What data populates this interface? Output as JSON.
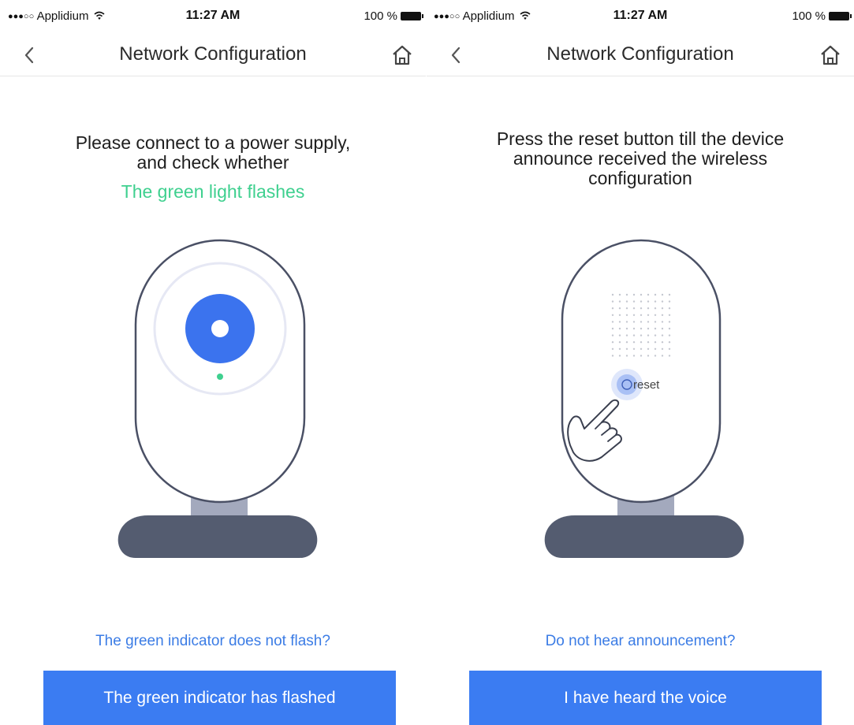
{
  "status_bar": {
    "signal": "●●●○○",
    "carrier": "Applidium",
    "time": "11:27 AM",
    "battery": "100 %"
  },
  "screens": [
    {
      "nav_title": "Network Configuration",
      "instruction_line1": "Please connect to a power supply,",
      "instruction_line2": "and check whether",
      "highlight": "The green light flashes",
      "link": "The green indicator does not flash?",
      "button": "The green indicator has flashed"
    },
    {
      "nav_title": "Network Configuration",
      "instruction_line1": "Press the reset button till the device",
      "instruction_line2": "announce received the wireless",
      "instruction_line3": "configuration",
      "reset_label": "reset",
      "link": "Do not hear announcement?",
      "button": "I have heard the voice"
    }
  ],
  "colors": {
    "accent": "#3b7cf2",
    "highlight_green": "#3fd08f",
    "device_outline": "#4a5065",
    "stand": "#545c70",
    "neck": "#a3a9bd"
  }
}
